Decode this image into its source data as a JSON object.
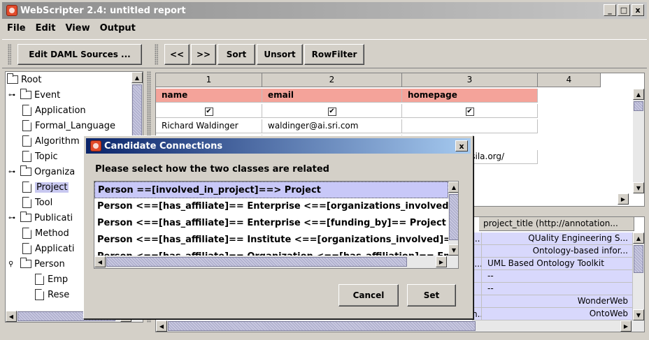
{
  "window": {
    "title": "WebScripter 2.4: untitled report",
    "min": "_",
    "max": "□",
    "close": "x"
  },
  "menu": [
    "File",
    "Edit",
    "View",
    "Output"
  ],
  "toolbar": {
    "edit_daml": "Edit DAML Sources ...",
    "prev": "<<",
    "next": ">>",
    "sort": "Sort",
    "unsort": "Unsort",
    "rowfilter": "RowFilter"
  },
  "tree": {
    "root": "Root",
    "nodes": [
      {
        "label": "Event",
        "type": "folder",
        "toggle": "o-"
      },
      {
        "label": "Application",
        "type": "doc"
      },
      {
        "label": "Formal_Language",
        "type": "doc"
      },
      {
        "label": "Algorithm",
        "type": "doc"
      },
      {
        "label": "Topic",
        "type": "doc"
      },
      {
        "label": "Organiza",
        "type": "folder",
        "toggle": "o-"
      },
      {
        "label": "Project",
        "type": "doc",
        "selected": true
      },
      {
        "label": "Tool",
        "type": "doc"
      },
      {
        "label": "Publicati",
        "type": "folder",
        "toggle": "o-"
      },
      {
        "label": "Method",
        "type": "doc"
      },
      {
        "label": "Applicati",
        "type": "doc"
      },
      {
        "label": "Person",
        "type": "folder",
        "toggle": "o"
      },
      {
        "label": "Emp",
        "type": "doc",
        "indent": 2
      },
      {
        "label": "Rese",
        "type": "doc",
        "indent": 2
      }
    ]
  },
  "grid": {
    "columns": [
      "1",
      "2",
      "3",
      "4"
    ],
    "headers": [
      "name",
      "email",
      "homepage"
    ],
    "check": "✔",
    "rows": [
      [
        "Richard Waldinger",
        "waldinger@ai.sri.com",
        ""
      ],
      [
        "",
        "",
        "ssila.org/"
      ]
    ]
  },
  "grid2": {
    "header": "project_title (http://annotation...",
    "rows": [
      "QUality Engineering S...",
      "Ontology-based infor...",
      "UML Based Ontology Toolkit",
      "--",
      "--",
      "WonderWeb",
      "OntoWeb"
    ],
    "left_fragments": [
      "...",
      "",
      "i...",
      "",
      "",
      "",
      "n..."
    ]
  },
  "dialog": {
    "title": "Candidate Connections",
    "close": "x",
    "prompt": "Please select how the two classes are related",
    "options": [
      "Person ==[involved_in_project]==> Project",
      "Person <==[has_affiliate]== Enterprise <==[organizations_involved]==",
      "Person <==[has_affiliate]== Enterprise <==[funding_by]== Project",
      "Person <==[has_affiliate]== Institute <==[organizations_involved]== P",
      "Person <==[has_affiliate]== Organization <==[has_affiliation]== Emp"
    ],
    "cancel": "Cancel",
    "set": "Set"
  },
  "colors": {
    "header_cell": "#f4a39a",
    "selection": "#c8c8f8",
    "dialog_title": "#0a246a"
  }
}
